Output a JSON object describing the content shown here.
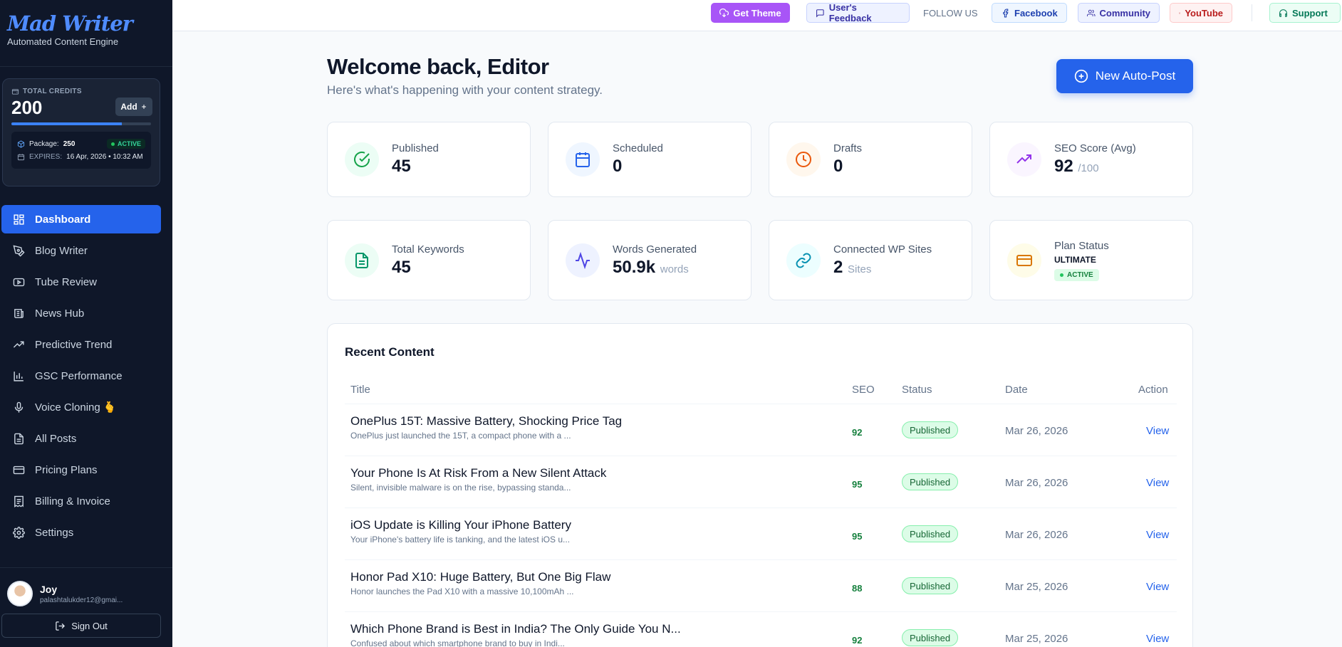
{
  "brand": {
    "name": "Mad Writer",
    "tagline": "Automated Content Engine"
  },
  "credits": {
    "label": "TOTAL CREDITS",
    "value": "200",
    "add_label": "Add",
    "fill_percent": 79,
    "package_label": "Package:",
    "package_value": "250",
    "status": "ACTIVE",
    "expires_label": "EXPIRES:",
    "expires_value": "16 Apr, 2026 • 10:32 AM"
  },
  "nav": {
    "dashboard": "Dashboard",
    "blog_writer": "Blog Writer",
    "tube_review": "Tube Review",
    "news_hub": "News Hub",
    "predictive_trend": "Predictive Trend",
    "gsc_performance": "GSC Performance",
    "voice_cloning": "Voice Cloning 🫰",
    "all_posts": "All Posts",
    "pricing_plans": "Pricing Plans",
    "billing_invoice": "Billing & Invoice",
    "settings": "Settings"
  },
  "user": {
    "name": "Joy",
    "email": "palashtalukder12@gmai...",
    "sign_out": "Sign Out"
  },
  "topbar": {
    "get_theme": "Get Theme",
    "feedback": "User's Feedback",
    "follow_us": "FOLLOW US",
    "facebook": "Facebook",
    "community": "Community",
    "youtube": "YouTube",
    "support": "Support"
  },
  "header": {
    "title": "Welcome back, Editor",
    "subtitle": "Here's what's happening with your content strategy.",
    "new_post": "New Auto-Post"
  },
  "stats": {
    "published": {
      "label": "Published",
      "value": "45"
    },
    "scheduled": {
      "label": "Scheduled",
      "value": "0"
    },
    "drafts": {
      "label": "Drafts",
      "value": "0"
    },
    "seo": {
      "label": "SEO Score (Avg)",
      "value": "92",
      "unit": "/100"
    },
    "keywords": {
      "label": "Total Keywords",
      "value": "45"
    },
    "words": {
      "label": "Words Generated",
      "value": "50.9k",
      "unit": "words"
    },
    "sites": {
      "label": "Connected WP Sites",
      "value": "2",
      "unit": "Sites"
    },
    "plan": {
      "label": "Plan Status",
      "value": "ULTIMATE",
      "status": "ACTIVE"
    }
  },
  "recent": {
    "title": "Recent Content",
    "columns": {
      "title": "Title",
      "seo": "SEO",
      "status": "Status",
      "date": "Date",
      "action": "Action"
    },
    "rows": [
      {
        "title": "OnePlus 15T: Massive Battery, Shocking Price Tag",
        "desc": "OnePlus just launched the 15T, a compact phone with a ...",
        "seo": "92",
        "status": "Published",
        "date": "Mar 26, 2026",
        "action": "View"
      },
      {
        "title": "Your Phone Is At Risk From a New Silent Attack",
        "desc": "Silent, invisible malware is on the rise, bypassing standa...",
        "seo": "95",
        "status": "Published",
        "date": "Mar 26, 2026",
        "action": "View"
      },
      {
        "title": "iOS Update is Killing Your iPhone Battery",
        "desc": "Your iPhone's battery life is tanking, and the latest iOS u...",
        "seo": "95",
        "status": "Published",
        "date": "Mar 26, 2026",
        "action": "View"
      },
      {
        "title": "Honor Pad X10: Huge Battery, But One Big Flaw",
        "desc": "Honor launches the Pad X10 with a massive 10,100mAh ...",
        "seo": "88",
        "status": "Published",
        "date": "Mar 25, 2026",
        "action": "View"
      },
      {
        "title": "Which Phone Brand is Best in India? The Only Guide You N...",
        "desc": "Confused about which smartphone brand to buy in Indi...",
        "seo": "92",
        "status": "Published",
        "date": "Mar 25, 2026",
        "action": "View"
      }
    ]
  },
  "colors": {
    "accent": "#2563eb",
    "sidebar": "#0f1729",
    "success": "#15803d",
    "theme_button": "#a855f7"
  }
}
